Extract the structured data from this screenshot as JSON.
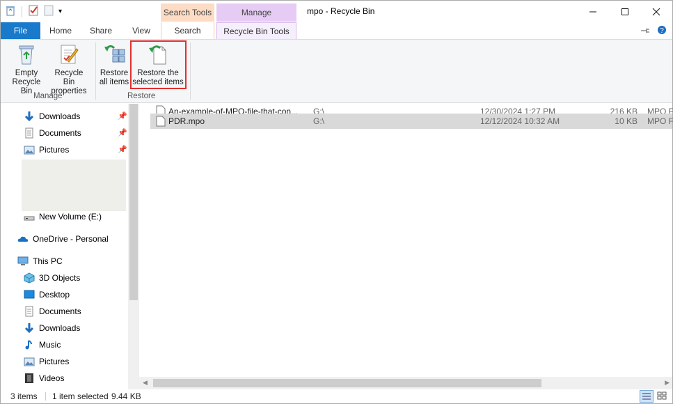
{
  "window": {
    "title": "mpo - Recycle Bin"
  },
  "context_headers": {
    "search_tools": "Search Tools",
    "manage": "Manage"
  },
  "tabs": {
    "file": "File",
    "home": "Home",
    "share": "Share",
    "view": "View",
    "search": "Search",
    "recycle_bin_tools": "Recycle Bin Tools"
  },
  "ribbon": {
    "empty": {
      "line1": "Empty",
      "line2": "Recycle Bin"
    },
    "properties": {
      "line1": "Recycle Bin",
      "line2": "properties"
    },
    "restore_all": {
      "line1": "Restore",
      "line2": "all items"
    },
    "restore_selected": {
      "line1": "Restore the",
      "line2": "selected items"
    },
    "groups": {
      "manage": "Manage",
      "restore": "Restore"
    }
  },
  "nav": {
    "quick_access": [
      "Downloads",
      "Documents",
      "Pictures"
    ],
    "new_volume": "New Volume (E:)",
    "onedrive": "OneDrive - Personal",
    "this_pc": "This PC",
    "pc_items": [
      "3D Objects",
      "Desktop",
      "Documents",
      "Downloads",
      "Music",
      "Pictures",
      "Videos"
    ]
  },
  "files": [
    {
      "name": "An-example-of-MPO-file-that-con...",
      "location": "G:\\",
      "date": "12/30/2024 1:27 PM",
      "size": "216 KB",
      "type": "MPO F"
    },
    {
      "name": "PDR.mpo",
      "location": "G:\\",
      "date": "12/12/2024 10:32 AM",
      "size": "10 KB",
      "type": "MPO F"
    }
  ],
  "status": {
    "count": "3 items",
    "selected": "1 item selected",
    "size": "9.44 KB"
  },
  "colors": {
    "file_tab": "#1979ca",
    "highlight": "#e03030",
    "search_tools": "#fcdcc4",
    "manage": "#e6ccf5"
  }
}
